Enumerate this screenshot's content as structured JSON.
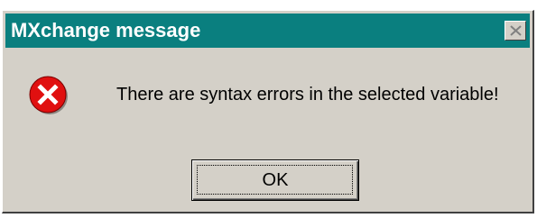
{
  "window": {
    "title": "MXchange message",
    "close_icon": "close-icon"
  },
  "content": {
    "icon": "error-icon",
    "message": "There are syntax errors in the selected variable!"
  },
  "buttons": {
    "ok_label": "OK"
  },
  "colors": {
    "titlebar": "#0a7f7f",
    "dialog_face": "#d4d0c8",
    "error_red": "#e01010"
  }
}
